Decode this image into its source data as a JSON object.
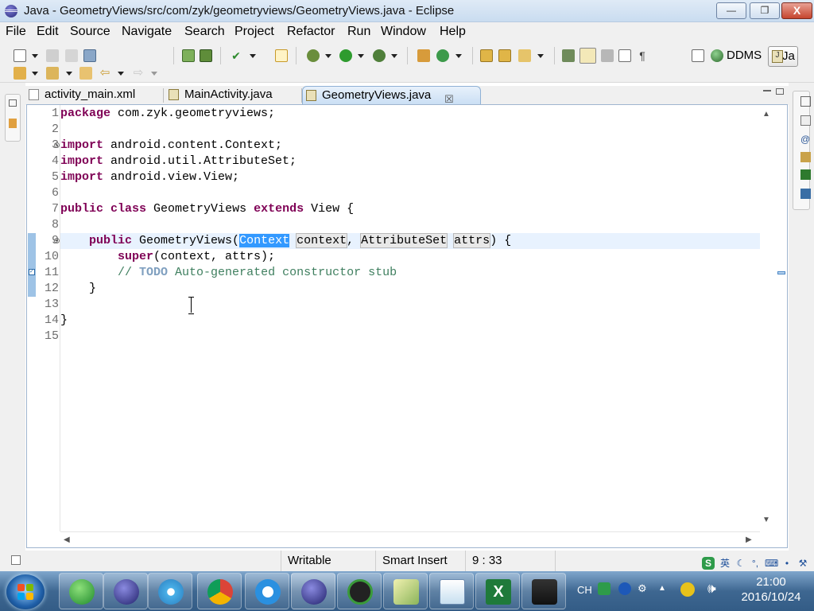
{
  "window": {
    "title": "Java - GeometryViews/src/com/zyk/geometryviews/GeometryViews.java - Eclipse",
    "min_glyph": "—",
    "max_glyph": "❐",
    "close_glyph": "X"
  },
  "menu": {
    "items": [
      "File",
      "Edit",
      "Source",
      "Navigate",
      "Search",
      "Project",
      "Refactor",
      "Run",
      "Window",
      "Help"
    ]
  },
  "perspectives": {
    "ddms_label": "DDMS",
    "java_label": "Ja"
  },
  "editor_tabs": [
    {
      "label": "activity_main.xml",
      "icon": "xml-file-icon",
      "active": false
    },
    {
      "label": "MainActivity.java",
      "icon": "java-file-icon",
      "active": false
    },
    {
      "label": "GeometryViews.java",
      "icon": "java-file-icon",
      "active": true,
      "close": "☒"
    }
  ],
  "code": {
    "line_numbers": [
      "1",
      "2",
      "3",
      "4",
      "5",
      "6",
      "7",
      "8",
      "9",
      "10",
      "11",
      "12",
      "13",
      "14",
      "15"
    ],
    "l1": {
      "kw": "package",
      "rest": " com.zyk.geometryviews;"
    },
    "l3": {
      "kw": "import",
      "rest": " android.content.Context;"
    },
    "l4": {
      "kw": "import",
      "rest": " android.util.AttributeSet;"
    },
    "l5": {
      "kw": "import",
      "rest": " android.view.View;"
    },
    "l7": {
      "kw1": "public",
      "kw2": "class",
      "name": " GeometryViews ",
      "kw3": "extends",
      "rest": " View {"
    },
    "l9": {
      "indent": "    ",
      "kw": "public",
      "ctor": " GeometryViews(",
      "t1": "Context",
      "sp1": " ",
      "p1": "context",
      "comma": ", ",
      "t2": "AttributeSet",
      "sp2": " ",
      "p2": "attrs",
      "end": ") {"
    },
    "l10": {
      "indent": "        ",
      "kw": "super",
      "rest": "(context, attrs);"
    },
    "l11": {
      "indent": "        ",
      "c1": "// ",
      "todo": "TODO",
      "c2": " Auto-generated constructor stub"
    },
    "l12": {
      "text": "    }"
    },
    "l14": {
      "text": "}"
    }
  },
  "status": {
    "writable": "Writable",
    "insert_mode": "Smart Insert",
    "position": "9 : 33"
  },
  "taskbar": {
    "apps": [
      "ie-icon",
      "eclipse-icon",
      "network-icon",
      "chrome-icon",
      "cloud-icon",
      "eclipse-icon",
      "amd-icon",
      "notes-icon",
      "notepad-icon",
      "excel-icon",
      "camera-icon"
    ],
    "lang": "CH",
    "time": "21:00",
    "date": "2016/10/24"
  },
  "ime": {
    "label": "英"
  },
  "colors": {
    "keyword": "#7f0055",
    "comment": "#3f7f5f",
    "todo": "#7f9fbf",
    "selection": "#3399ff",
    "current_line": "#e8f2fe"
  }
}
